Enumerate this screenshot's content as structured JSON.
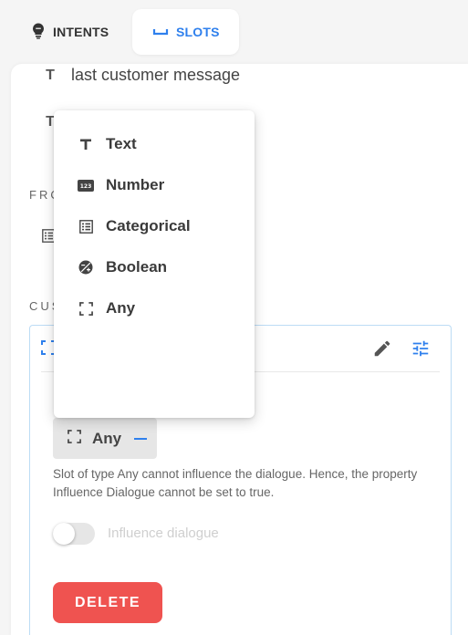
{
  "tabs": {
    "intents": {
      "label": "INTENTS",
      "icon": "lightbulb-icon"
    },
    "slots": {
      "label": "SLOTS",
      "icon": "space-bar-icon",
      "active": true
    }
  },
  "slots_list": [
    {
      "type_glyph": "T",
      "name": "last customer message"
    },
    {
      "type_glyph": "T",
      "name": ""
    }
  ],
  "sections": {
    "from": "FRO",
    "custom": "CUS"
  },
  "card": {
    "type_label": "Any",
    "help_text": "Slot of type Any cannot influence the dialogue. Hence, the property Influence Dialogue cannot be set to true.",
    "toggle_label": "Influence dialogue",
    "toggle_on": false,
    "delete_label": "DELETE"
  },
  "type_menu": {
    "items": [
      {
        "label": "Text",
        "icon": "text-type-icon"
      },
      {
        "label": "Number",
        "icon": "number-type-icon"
      },
      {
        "label": "Categorical",
        "icon": "list-type-icon"
      },
      {
        "label": "Boolean",
        "icon": "boolean-type-icon"
      },
      {
        "label": "Any",
        "icon": "any-type-icon"
      }
    ]
  },
  "colors": {
    "accent": "#2f80ed",
    "delete": "#ef5350",
    "card_border": "#bcdcf5"
  }
}
